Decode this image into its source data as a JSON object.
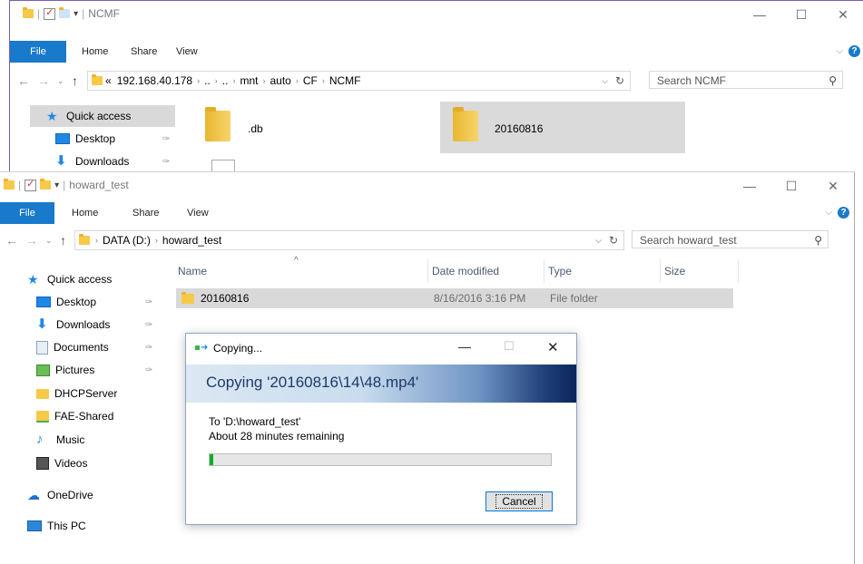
{
  "back_window": {
    "title": "NCMF",
    "ribbon": {
      "file": "File",
      "tabs": [
        "Home",
        "Share",
        "View"
      ]
    },
    "address": {
      "parts": [
        "«",
        "192.168.40.178",
        "..",
        "..",
        "mnt",
        "auto",
        "CF",
        "NCMF"
      ]
    },
    "search_placeholder": "Search NCMF",
    "sidebar": [
      {
        "label": "Quick access",
        "icon": "star-icon"
      },
      {
        "label": "Desktop",
        "icon": "desktop-icon"
      },
      {
        "label": "Downloads",
        "icon": "downloads-icon"
      }
    ],
    "items": [
      ".db",
      "20160816"
    ]
  },
  "front_window": {
    "title": "howard_test",
    "ribbon": {
      "file": "File",
      "tabs": [
        "Home",
        "Share",
        "View"
      ]
    },
    "address": {
      "parts": [
        "DATA (D:)",
        "howard_test"
      ]
    },
    "search_placeholder": "Search howard_test",
    "columns": [
      "Name",
      "Date modified",
      "Type",
      "Size"
    ],
    "rows": [
      {
        "name": "20160816",
        "modified": "8/16/2016 3:16 PM",
        "type": "File folder",
        "size": ""
      }
    ],
    "sidebar": [
      {
        "label": "Quick access",
        "icon": "star-icon",
        "pinned": false
      },
      {
        "label": "Desktop",
        "icon": "desktop-icon",
        "pinned": true
      },
      {
        "label": "Downloads",
        "icon": "downloads-icon",
        "pinned": true
      },
      {
        "label": "Documents",
        "icon": "documents-icon",
        "pinned": true
      },
      {
        "label": "Pictures",
        "icon": "pictures-icon",
        "pinned": true
      },
      {
        "label": "DHCPServer",
        "icon": "folder-icon",
        "pinned": false
      },
      {
        "label": "FAE-Shared",
        "icon": "network-folder-icon",
        "pinned": false
      },
      {
        "label": "Music",
        "icon": "music-icon",
        "pinned": false
      },
      {
        "label": "Videos",
        "icon": "videos-icon",
        "pinned": false
      },
      {
        "label": "OneDrive",
        "icon": "onedrive-icon",
        "pinned": false
      },
      {
        "label": "This PC",
        "icon": "pc-icon",
        "pinned": false
      }
    ]
  },
  "dialog": {
    "title": "Copying...",
    "heading": "Copying '20160816\\14\\48.mp4'",
    "destination": "To 'D:\\howard_test'",
    "remaining": "About 28 minutes remaining",
    "progress_fraction": 0.01,
    "cancel_label": "Cancel"
  },
  "colors": {
    "accent": "#1979ca",
    "selection": "#cce8ff",
    "progress": "#06b025",
    "window_border": "#7a5fb4"
  }
}
